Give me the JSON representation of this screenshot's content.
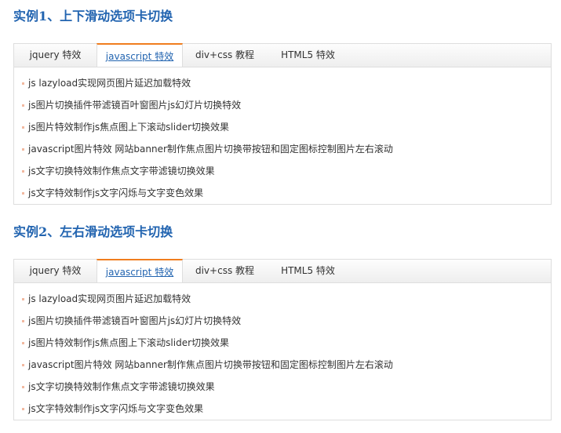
{
  "examples": [
    {
      "title": "实例1、上下滑动选项卡切换",
      "tabs": [
        {
          "label": "jquery 特效",
          "active": false
        },
        {
          "label": "javascript 特效",
          "active": true
        },
        {
          "label": "div+css 教程",
          "active": false
        },
        {
          "label": "HTML5 特效",
          "active": false
        }
      ],
      "items": [
        "js lazyload实现网页图片延迟加载特效",
        "js图片切换插件带滤镜百叶窗图片js幻灯片切换特效",
        "js图片特效制作js焦点图上下滚动slider切换效果",
        "javascript图片特效 网站banner制作焦点图片切换带按钮和固定图标控制图片左右滚动",
        "js文字切换特效制作焦点文字带滤镜切换效果",
        "js文字特效制作js文字闪烁与文字变色效果"
      ]
    },
    {
      "title": "实例2、左右滑动选项卡切换",
      "tabs": [
        {
          "label": "jquery 特效",
          "active": false
        },
        {
          "label": "javascript 特效",
          "active": true
        },
        {
          "label": "div+css 教程",
          "active": false
        },
        {
          "label": "HTML5 特效",
          "active": false
        }
      ],
      "items": [
        "js lazyload实现网页图片延迟加载特效",
        "js图片切换插件带滤镜百叶窗图片js幻灯片切换特效",
        "js图片特效制作js焦点图上下滚动slider切换效果",
        "javascript图片特效 网站banner制作焦点图片切换带按钮和固定图标控制图片左右滚动",
        "js文字切换特效制作焦点文字带滤镜切换效果",
        "js文字特效制作js文字闪烁与文字变色效果"
      ]
    }
  ],
  "colors": {
    "title": "#2264b0",
    "active_tab_top_border": "#f07d1e",
    "border": "#dedede",
    "text": "#333333",
    "bullet": "#f2b9a0"
  }
}
